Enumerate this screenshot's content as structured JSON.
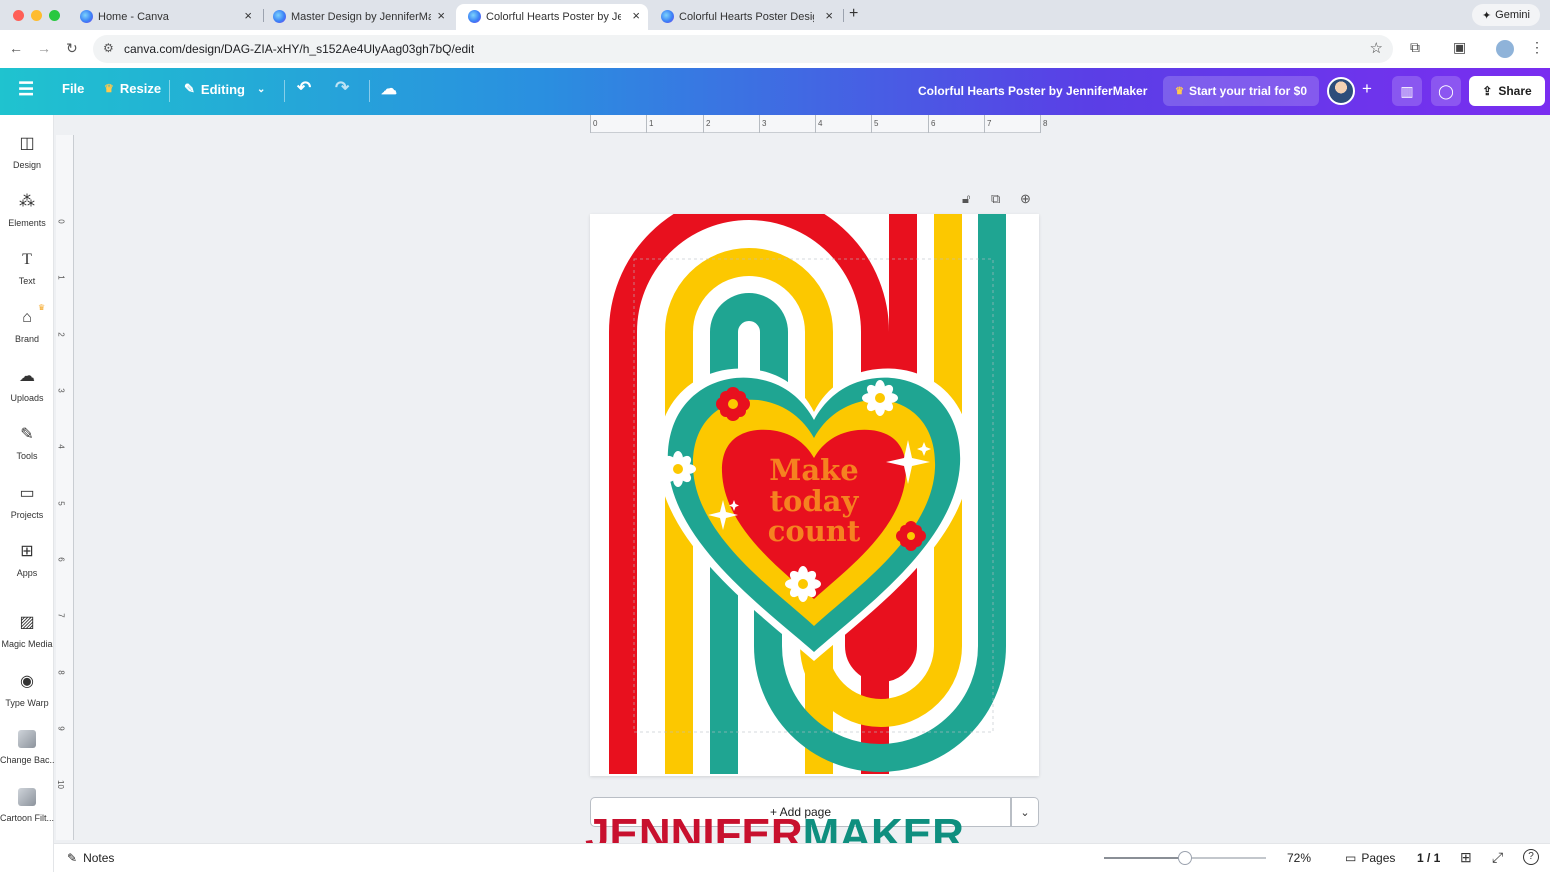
{
  "browser": {
    "tabs": [
      {
        "title": "Home - Canva",
        "active": false
      },
      {
        "title": "Master Design by JenniferMal",
        "active": false
      },
      {
        "title": "Colorful Hearts Poster by Jen",
        "active": true
      },
      {
        "title": "Colorful Hearts Poster Design",
        "active": false
      }
    ],
    "gemini_label": "Gemini",
    "url": "canva.com/design/DAG-ZIA-xHY/h_s152Ae4UlyAag03gh7bQ/edit"
  },
  "header": {
    "file_label": "File",
    "resize_label": "Resize",
    "editing_label": "Editing",
    "doc_title": "Colorful Hearts Poster by JenniferMaker",
    "trial_label": "Start your trial for $0",
    "share_label": "Share"
  },
  "sidebar": {
    "items": [
      {
        "label": "Design",
        "icon": "design-icon"
      },
      {
        "label": "Elements",
        "icon": "elements-icon"
      },
      {
        "label": "Text",
        "icon": "text-icon"
      },
      {
        "label": "Brand",
        "icon": "brand-icon"
      },
      {
        "label": "Uploads",
        "icon": "uploads-icon"
      },
      {
        "label": "Tools",
        "icon": "tools-icon"
      },
      {
        "label": "Projects",
        "icon": "projects-icon"
      },
      {
        "label": "Apps",
        "icon": "apps-icon"
      },
      {
        "label": "Magic Media",
        "icon": "magic-media-icon"
      },
      {
        "label": "Type Warp",
        "icon": "type-warp-icon"
      },
      {
        "label": "Change Bac...",
        "icon": "change-background-icon"
      },
      {
        "label": "Cartoon Filt...",
        "icon": "cartoon-filter-icon"
      }
    ]
  },
  "rulers": {
    "horizontal": [
      "0",
      "1",
      "2",
      "3",
      "4",
      "5",
      "6",
      "7",
      "8"
    ],
    "vertical": [
      "0",
      "1",
      "2",
      "3",
      "4",
      "5",
      "6",
      "7",
      "8",
      "9",
      "10"
    ]
  },
  "poster": {
    "text_line1": "Make",
    "text_line2": "today",
    "text_line3": "count",
    "colors": {
      "red": "#e8101e",
      "yellow": "#fcc800",
      "teal": "#1fa592",
      "white": "#ffffff",
      "text": "#f58220"
    }
  },
  "canvas": {
    "add_page_label": "+ Add page"
  },
  "watermark": {
    "part1": "JENNIFER",
    "part2": "MAKER"
  },
  "bottombar": {
    "notes_label": "Notes",
    "zoom": "72%",
    "zoom_fraction": 0.5,
    "pages_label": "Pages",
    "page_count": "1 / 1"
  }
}
